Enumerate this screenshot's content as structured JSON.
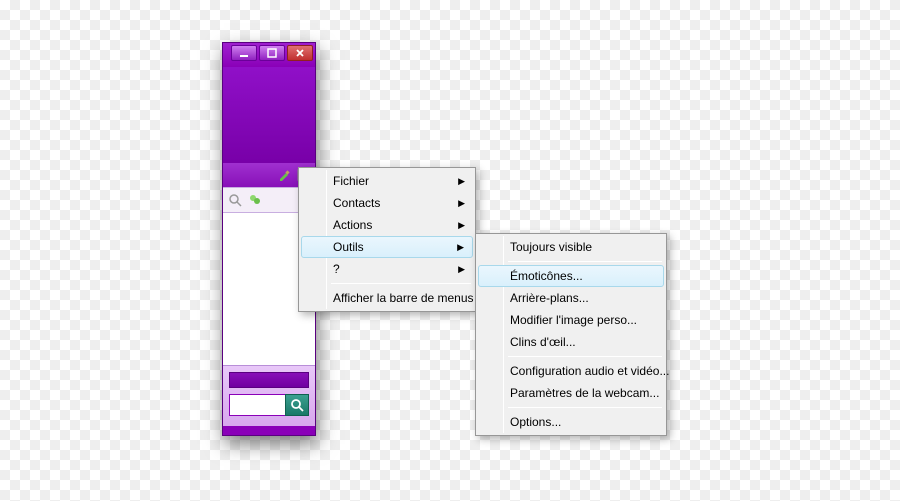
{
  "window_controls": {
    "minimize": "–",
    "maximize": "▭",
    "close": "X"
  },
  "main_menu": {
    "items": [
      {
        "label": "Fichier",
        "submenu": true
      },
      {
        "label": "Contacts",
        "submenu": true
      },
      {
        "label": "Actions",
        "submenu": true
      },
      {
        "label": "Outils",
        "submenu": true,
        "hover": true
      },
      {
        "label": "?",
        "submenu": true
      }
    ],
    "footer_item": {
      "label": "Afficher la barre de menus"
    }
  },
  "tools_submenu": {
    "group1": [
      {
        "label": "Toujours visible"
      }
    ],
    "group2": [
      {
        "label": "Émoticônes...",
        "hover": true
      },
      {
        "label": "Arrière-plans..."
      },
      {
        "label": "Modifier l'image perso..."
      },
      {
        "label": "Clins d'œil..."
      }
    ],
    "group3": [
      {
        "label": "Configuration audio et vidéo..."
      },
      {
        "label": "Paramètres de la webcam..."
      }
    ],
    "group4": [
      {
        "label": "Options..."
      }
    ]
  },
  "icons": {
    "brush": "brush-icon",
    "page": "page-icon",
    "search": "search-icon",
    "presence": "presence-icon",
    "search_go": "search-go-icon"
  }
}
